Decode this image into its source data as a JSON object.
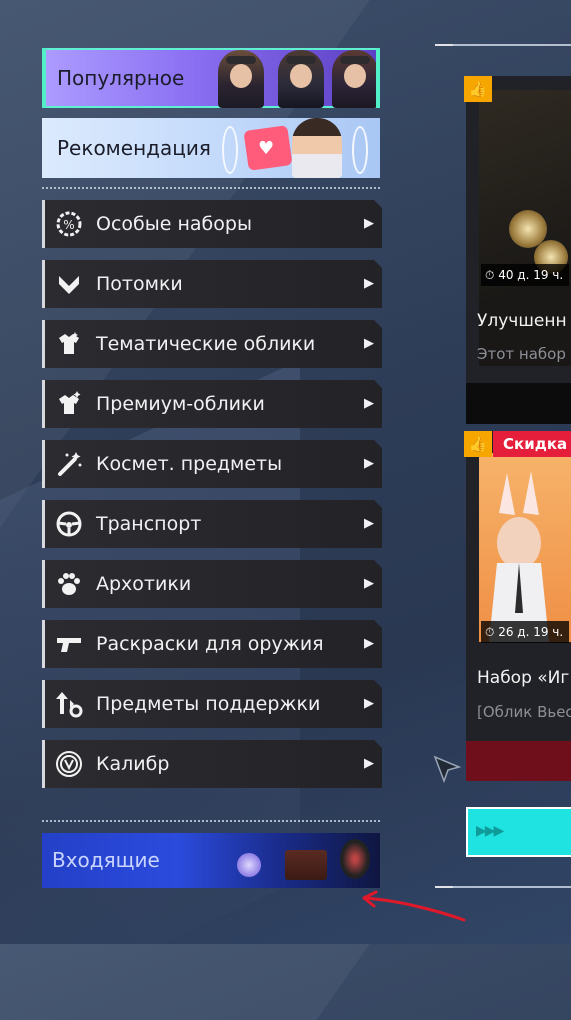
{
  "hero": {
    "popular": "Популярное",
    "recommended": "Рекомендация"
  },
  "menu": {
    "items": [
      {
        "label": "Особые наборы",
        "icon": "special-bundle-icon"
      },
      {
        "label": "Потомки",
        "icon": "descendant-icon"
      },
      {
        "label": "Тематические облики",
        "icon": "themed-skin-icon"
      },
      {
        "label": "Премиум-облики",
        "icon": "premium-skin-icon"
      },
      {
        "label": "Космет. предметы",
        "icon": "cosmetic-wand-icon"
      },
      {
        "label": "Транспорт",
        "icon": "steering-wheel-icon"
      },
      {
        "label": "Архотики",
        "icon": "paw-icon"
      },
      {
        "label": "Раскраски для оружия",
        "icon": "gun-icon"
      },
      {
        "label": "Предметы поддержки",
        "icon": "support-items-icon"
      },
      {
        "label": "Калибр",
        "icon": "caliber-icon"
      }
    ],
    "arrow": "▶"
  },
  "inbox": {
    "label": "Входящие"
  },
  "store": {
    "card1": {
      "timer": "40 д. 19 ч.",
      "title": "Улучшенн",
      "subtitle": "Этот набор"
    },
    "card2": {
      "badge": "Скидка",
      "timer": "26 д. 19 ч.",
      "title": "Набор «Иг",
      "subtitle": "[Облик Вьес"
    }
  },
  "icons": {
    "thumb": "👍",
    "stopwatch": "⏱"
  },
  "colors": {
    "accent_teal": "#1ee3e0",
    "popular_purple": "#8a6ff2",
    "discount_red": "#e41e3b",
    "thumb_orange": "#f7a600",
    "annotation_red": "#e0192a"
  }
}
